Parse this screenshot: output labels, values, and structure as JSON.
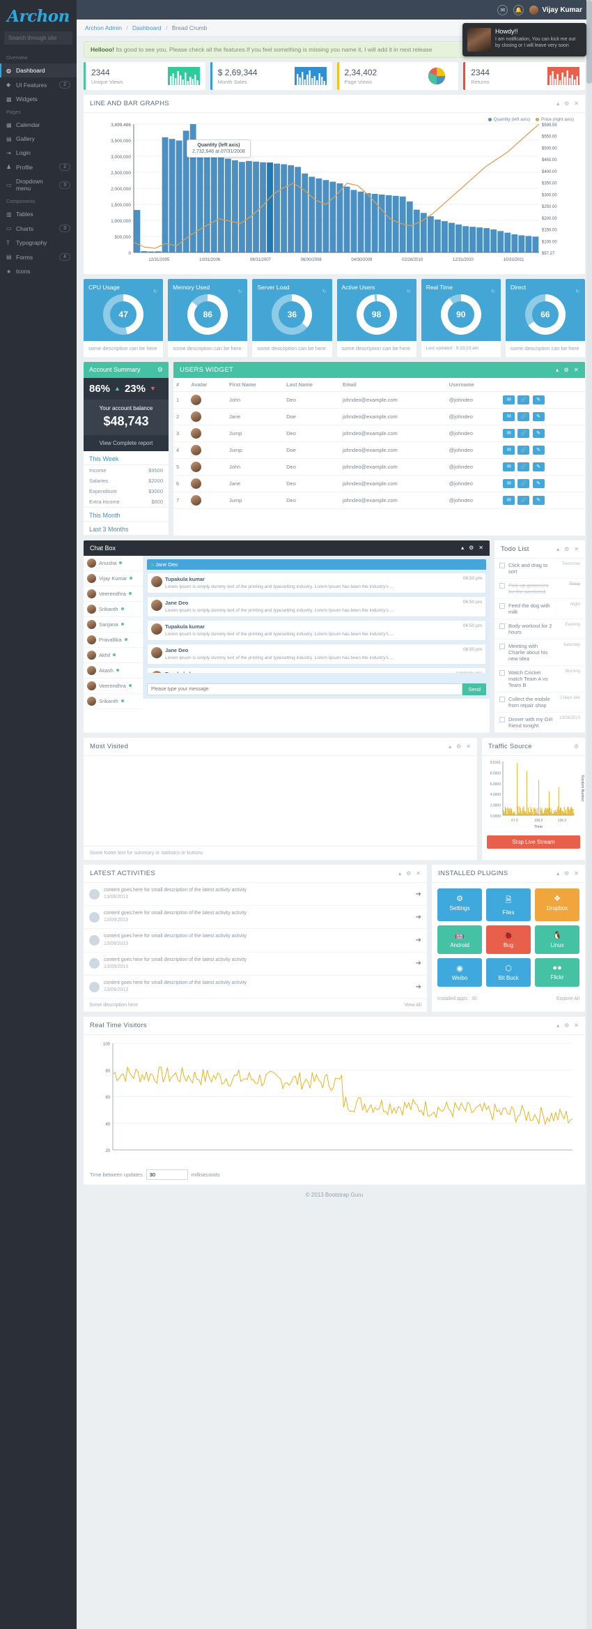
{
  "brand": {
    "name": "Archon"
  },
  "sidebar": {
    "search_placeholder": "Search through site",
    "sections": [
      {
        "title": "Overview",
        "items": [
          {
            "label": "Dashboard",
            "icon": "dashboard-icon",
            "badge": "",
            "active": true
          },
          {
            "label": "UI Features",
            "icon": "droplet-icon",
            "badge": "2"
          },
          {
            "label": "Widgets",
            "icon": "widgets-icon",
            "badge": ""
          }
        ]
      },
      {
        "title": "Pages",
        "items": [
          {
            "label": "Calendar",
            "icon": "calendar-icon",
            "badge": ""
          },
          {
            "label": "Gallery",
            "icon": "image-icon",
            "badge": ""
          },
          {
            "label": "Login",
            "icon": "login-icon",
            "badge": ""
          },
          {
            "label": "Profile",
            "icon": "user-icon",
            "badge": "2"
          },
          {
            "label": "Dropdown menu",
            "icon": "folder-icon",
            "badge": "3"
          }
        ]
      },
      {
        "title": "Components",
        "items": [
          {
            "label": "Tables",
            "icon": "table-icon",
            "badge": ""
          },
          {
            "label": "Charts",
            "icon": "folder-icon",
            "badge": "3"
          },
          {
            "label": "Typography",
            "icon": "type-icon",
            "badge": ""
          },
          {
            "label": "Forms",
            "icon": "form-icon",
            "badge": "4"
          },
          {
            "label": "Icons",
            "icon": "star-icon",
            "badge": ""
          }
        ]
      }
    ]
  },
  "topbar": {
    "user": "Vijay Kumar",
    "mail_icon": "envelope-icon",
    "bell_icon": "bell-icon"
  },
  "breadcrumb": {
    "items": [
      "Archon Admin",
      "Dashboard",
      "Bread Crumb"
    ]
  },
  "alert": {
    "bold": "Hellooo!",
    "text": "Its good to see you. Please check all the features.If you feel something is missing you name it, I will add it in next release"
  },
  "toast": {
    "title": "Howdy!!",
    "body": "I am notification, You can kick me out by closing or I will leave very soon"
  },
  "stats": [
    {
      "value": "2344",
      "label": "Unique Views",
      "color": "#48c39a"
    },
    {
      "value": "$ 2,69,344",
      "label": "Month Sales",
      "color": "#3498db"
    },
    {
      "value": "2,34,402",
      "label": "Page Views",
      "color": "#f1c40f"
    },
    {
      "value": "2344",
      "label": "Returns",
      "color": "#e74c3c"
    }
  ],
  "big_chart": {
    "title": "LINE AND BAR GRAPHS",
    "legend": [
      {
        "label": "Quantity (left axis)",
        "color": "#4a90c2"
      },
      {
        "label": "Price (right axis)",
        "color": "#d8a05a"
      }
    ],
    "tooltip": {
      "title": "Quantity (left axis)",
      "value": "2,732,646 at 07/31/2008"
    }
  },
  "chart_data": {
    "type": "bar",
    "title": "LINE AND BAR GRAPHS",
    "xlabel": "",
    "ylabel": "Quantity (left axis)",
    "y2label": "Price (right axis)",
    "ylim": [
      0,
      3899486
    ],
    "y2lim": [
      57.27,
      599.55
    ],
    "yticks": [
      "3,899,486",
      "3,500,000",
      "3,000,000",
      "2,500,000",
      "2,000,000",
      "1,500,000",
      "1,000,000",
      "500,000",
      "0"
    ],
    "y2ticks": [
      "$599.55",
      "$550.00",
      "$500.00",
      "$450.00",
      "$400.00",
      "$350.00",
      "$300.00",
      "$250.00",
      "$200.00",
      "$150.00",
      "$100.00",
      "$57.27"
    ],
    "xticks": [
      "12/31/2005",
      "10/31/2006",
      "08/31/2007",
      "06/30/2008",
      "04/30/2009",
      "02/28/2010",
      "12/31/2010",
      "10/31/2011"
    ],
    "grid": true,
    "legend_position": "top-right",
    "series": [
      {
        "name": "Quantity (left axis)",
        "type": "bar",
        "color": "#4a90c2",
        "values": [
          1290000,
          40000,
          30000,
          35000,
          3500000,
          3450000,
          3400000,
          3700000,
          3899486,
          3300000,
          3250000,
          3200000,
          2900000,
          2850000,
          2800000,
          2750000,
          2780000,
          2760000,
          2740000,
          2732646,
          2700000,
          2680000,
          2650000,
          2600000,
          2400000,
          2300000,
          2250000,
          2200000,
          2150000,
          2100000,
          2000000,
          1900000,
          1850000,
          1800000,
          1780000,
          1760000,
          1740000,
          1720000,
          1700000,
          1550000,
          1300000,
          1200000,
          1100000,
          1000000,
          950000,
          900000,
          850000,
          800000,
          780000,
          760000,
          740000,
          700000,
          650000,
          600000,
          550000,
          520000,
          500000,
          480000
        ]
      },
      {
        "name": "Price (right axis)",
        "type": "line",
        "color": "#d8a05a",
        "values": [
          100,
          80,
          75,
          95,
          85,
          120,
          150,
          175,
          200,
          190,
          180,
          210,
          250,
          300,
          330,
          350,
          320,
          280,
          260,
          300,
          350,
          340,
          300,
          250,
          200,
          180,
          170,
          190,
          220,
          260,
          300,
          340,
          380,
          420,
          450,
          480,
          520,
          560,
          599.55
        ]
      }
    ]
  },
  "circles": [
    {
      "name": "CPU Usage",
      "value": "47",
      "desc": "some description can be here",
      "pct": 47
    },
    {
      "name": "Memory Used",
      "value": "86",
      "desc": "some description can be here",
      "pct": 86
    },
    {
      "name": "Server Load",
      "value": "36",
      "desc": "some description can be here",
      "pct": 36
    },
    {
      "name": "Active Users",
      "value": "98",
      "desc": "some description can be here",
      "pct": 98
    },
    {
      "name": "Real Time",
      "value": "90",
      "desc": "Last updated : 9:33:23 am",
      "pct": 90
    },
    {
      "name": "Direct",
      "value": "66",
      "desc": "some description can be here",
      "pct": 66
    }
  ],
  "account": {
    "title": "Account Summary",
    "pct_up": "86%",
    "pct_down": "23%",
    "balance_label": "Your account balance",
    "balance": "$48,743",
    "complete_report": "View Complete report",
    "this_week_label": "This Week",
    "rows": [
      {
        "label": "Income",
        "value": "$9500"
      },
      {
        "label": "Salaries",
        "value": "$2000"
      },
      {
        "label": "Expenditure",
        "value": "$3000"
      },
      {
        "label": "Extra income",
        "value": "$600"
      }
    ],
    "this_month_label": "This Month",
    "last_3_label": "Last 3 Months"
  },
  "users_widget": {
    "title": "USERS WIDGET",
    "columns": [
      "#",
      "Avatar",
      "First Name",
      "Last Name",
      "Email",
      "Username",
      ""
    ],
    "rows": [
      {
        "n": "1",
        "first": "John",
        "last": "Deo",
        "email": "johndeo@example.com",
        "user": "@johndeo"
      },
      {
        "n": "2",
        "first": "Jane",
        "last": "Doe",
        "email": "johndeo@example.com",
        "user": "@johndeo"
      },
      {
        "n": "3",
        "first": "Jump",
        "last": "Deo",
        "email": "johndeo@example.com",
        "user": "@johndeo"
      },
      {
        "n": "4",
        "first": "Jump.",
        "last": "Doe",
        "email": "johndeo@example.com",
        "user": "@johndeo"
      },
      {
        "n": "5",
        "first": "John",
        "last": "Deo",
        "email": "johndeo@example.com",
        "user": "@johndeo"
      },
      {
        "n": "6",
        "first": "Jane",
        "last": "Deo",
        "email": "johndeo@example.com",
        "user": "@johndeo"
      },
      {
        "n": "7",
        "first": "Jump",
        "last": "Deo",
        "email": "johndeo@example.com",
        "user": "@johndeo"
      }
    ]
  },
  "chat": {
    "title": "Chat Box",
    "active_user": "Jane Deo",
    "input_placeholder": "Please type your message",
    "send_label": "Send",
    "users": [
      {
        "name": "Anusha"
      },
      {
        "name": "Vijay Kumar"
      },
      {
        "name": "Veerendhra"
      },
      {
        "name": "Srikanth"
      },
      {
        "name": "Sanjana"
      },
      {
        "name": "Pravallika"
      },
      {
        "name": "Akhil"
      },
      {
        "name": "Akash"
      },
      {
        "name": "Veerendhra"
      },
      {
        "name": "Srikanth"
      }
    ],
    "messages": [
      {
        "name": "Tupakula kumar",
        "time": "06:50 pm",
        "text": "Lorem ipsum is simply dummy text of the printing and typesetting industry. Lorem Ipsum has been the industry's ..."
      },
      {
        "name": "Jane Deo",
        "time": "06:50 pm",
        "text": "Lorem ipsum is simply dummy text of the printing and typesetting industry. Lorem Ipsum has been the industry's ..."
      },
      {
        "name": "Tupakula kumar",
        "time": "06:50 pm",
        "text": "Lorem ipsum is simply dummy text of the printing and typesetting industry. Lorem Ipsum has been the industry's ..."
      },
      {
        "name": "Jane Deo",
        "time": "06:50 pm",
        "text": "Lorem ipsum is simply dummy text of the printing and typesetting industry. Lorem Ipsum has been the industry's ..."
      },
      {
        "name": "Tupakula kumar",
        "time": "a minute ago",
        "text": ""
      }
    ]
  },
  "todo": {
    "title": "Todo List",
    "items": [
      {
        "text": "Click and drag to sort",
        "meta": "Tomorrow",
        "done": false
      },
      {
        "text": "Pick up groceries for the weekend",
        "meta": "Today",
        "done": true
      },
      {
        "text": "Feed the dog with milk",
        "meta": "Night",
        "done": false
      },
      {
        "text": "Body workout for 2 hours",
        "meta": "Evening",
        "done": false
      },
      {
        "text": "Meeting with Charlie about his new idea",
        "meta": "Saturday",
        "done": false
      },
      {
        "text": "Watch Cricket match Team A vs Team B",
        "meta": "Morning",
        "done": false
      },
      {
        "text": "Collect the mobile from repair shop",
        "meta": "2 days late",
        "done": false
      },
      {
        "text": "Dinner with my Girl friend tonight",
        "meta": "13/06/2013",
        "done": false
      }
    ]
  },
  "most_visited": {
    "title": "Most Visited",
    "footer": "Some footer text for summary or statistics or buttons"
  },
  "traffic": {
    "title": "Traffic Source",
    "stop_label": "Stop Live Stream",
    "xlabel": "Time",
    "ylabel": "Random Number",
    "yticks": [
      "9.5161",
      "8.0000",
      "6.0000",
      "4.0000",
      "2.0000",
      "0.0000"
    ],
    "xticks": [
      "67.0",
      "108.0",
      "136.0"
    ]
  },
  "activities": {
    "title": "LATEST ACTIVITIES",
    "items": [
      {
        "text": "content goes here for small description of the latest activity activity",
        "date": "13/09/2013"
      },
      {
        "text": "content goes here for small description of the latest activity activity",
        "date": "13/09/2013"
      },
      {
        "text": "content goes here for small description of the latest activity activity",
        "date": "13/09/2013"
      },
      {
        "text": "content goes here for small description of the latest activity activity",
        "date": "13/09/2013"
      },
      {
        "text": "content goes here for small description of the latest activity activity",
        "date": "13/09/2013"
      }
    ],
    "footer_left": "Some description here",
    "footer_right": "View All"
  },
  "plugins": {
    "title": "INSTALLED PLUGINS",
    "items": [
      {
        "label": "Settings",
        "color": "#3fa9de",
        "icon": "gear-icon"
      },
      {
        "label": "Files",
        "color": "#3fa9de",
        "icon": "file-icon"
      },
      {
        "label": "Dropbox",
        "color": "#f0a63c",
        "icon": "dropbox-icon"
      },
      {
        "label": "Android",
        "color": "#45c1a4",
        "icon": "android-icon"
      },
      {
        "label": "Bug",
        "color": "#e8604c",
        "icon": "bug-icon"
      },
      {
        "label": "Linux",
        "color": "#45c1a4",
        "icon": "linux-icon"
      },
      {
        "label": "Weibo",
        "color": "#3fa9de",
        "icon": "weibo-icon"
      },
      {
        "label": "Bit Buck",
        "color": "#3fa9de",
        "icon": "bitbucket-icon"
      },
      {
        "label": "Flickr",
        "color": "#45c1a4",
        "icon": "flickr-icon"
      }
    ],
    "footer_left": "Installed apps : 30",
    "footer_right": "Explore All"
  },
  "rtv": {
    "title": "Real Time Visitors",
    "between_label": "Time between updates",
    "interval_value": "30",
    "ms_label": "milliseconds",
    "yticks": [
      "100",
      "80",
      "60",
      "40",
      "20"
    ]
  },
  "footer": {
    "text": "© 2013 Bootstrap Guru"
  }
}
